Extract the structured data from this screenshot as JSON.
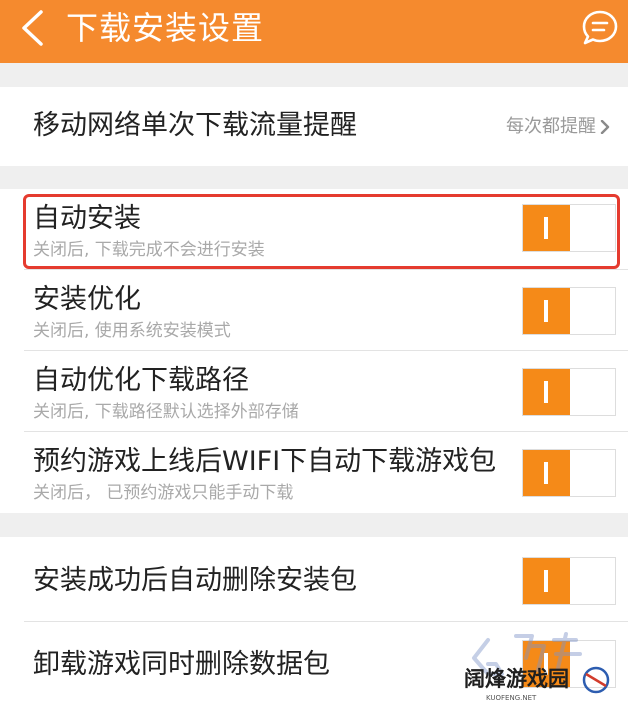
{
  "colors": {
    "header_bg": "#f58a2e",
    "toggle_on": "#f58a18",
    "highlight": "#e53b2f",
    "page_bg": "#efefef"
  },
  "header": {
    "title": "下载安装设置",
    "back_icon": "chevron-left-icon",
    "action_icon": "message-icon"
  },
  "data_reminder": {
    "title": "移动网络单次下载流量提醒",
    "value": "每次都提醒"
  },
  "install_settings": [
    {
      "title": "自动安装",
      "subtitle": "关闭后, 下载完成不会进行安装",
      "on": true
    },
    {
      "title": "安装优化",
      "subtitle": "关闭后, 使用系统安装模式",
      "on": true
    },
    {
      "title": "自动优化下载路径",
      "subtitle": "关闭后, 下载路径默认选择外部存储",
      "on": true
    },
    {
      "title": "预约游戏上线后WIFI下自动下载游戏包",
      "subtitle": "关闭后， 已预约游戏只能手动下载",
      "on": true
    }
  ],
  "cleanup_settings": [
    {
      "title": "安装成功后自动删除安装包",
      "on": true
    },
    {
      "title": "卸载游戏同时删除数据包",
      "on": true
    }
  ],
  "watermark": {
    "text": "阔烽游戏园",
    "sub": "KUOFENG.NET"
  }
}
